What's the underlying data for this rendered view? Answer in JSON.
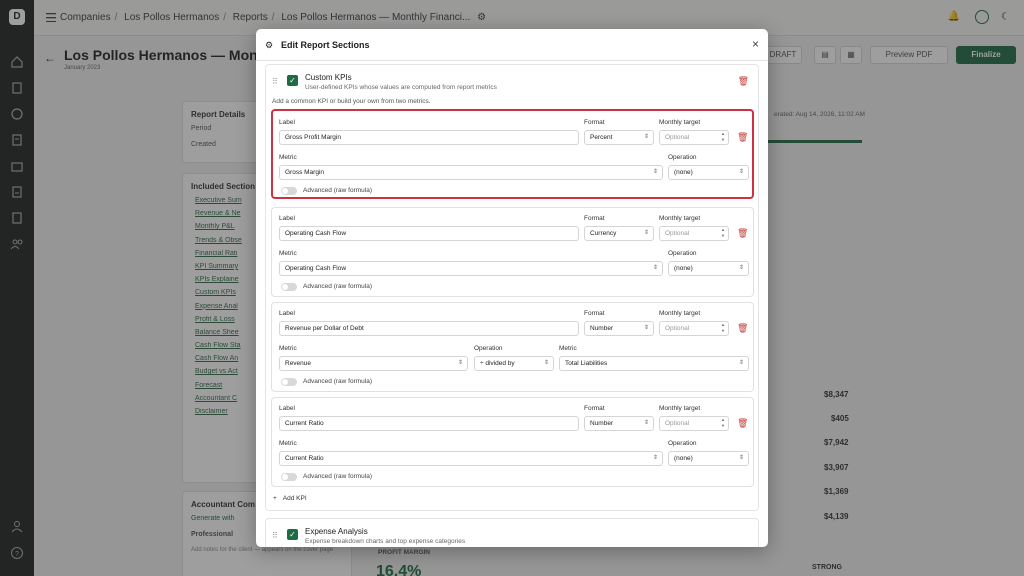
{
  "breadcrumb": [
    "Companies",
    "Los Pollos Hermanos",
    "Reports",
    "Los Pollos Hermanos — Monthly Financi..."
  ],
  "page": {
    "title": "Los Pollos Hermanos — Month",
    "subtitle": "January 2023",
    "draft_label": "DRAFT",
    "preview_label": "Preview PDF",
    "finalize_label": "Finalize",
    "generated_label": "erated: Aug 14, 2026, 11:02 AM"
  },
  "report_details": {
    "title": "Report Details",
    "period_label": "Period",
    "created_label": "Created"
  },
  "included_sections": {
    "title": "Included Section",
    "items": [
      "Executive Sum",
      "Revenue & Ne",
      "Monthly P&L",
      "Trends & Obse",
      "Financial Rati",
      "KPI Summary",
      "KPIs Explaine",
      "Custom KPIs",
      "Expense Anal",
      "Profit & Loss",
      "Balance Shee",
      "Cash Flow Sta",
      "Cash Flow An",
      "Budget vs Act",
      "Forecast",
      "Accountant C",
      "Disclaimer"
    ]
  },
  "accountant": {
    "title": "Accountant Com",
    "generate_label": "Generate with",
    "tab_professional": "Professional",
    "note": "Add notes for the client — appears on the cover page"
  },
  "background_values": [
    "$8,347",
    "$405",
    "$7,942",
    "$3,907",
    "$1,369",
    "$4,139"
  ],
  "profit_margin": {
    "label": "PROFIT MARGIN",
    "value": "16.4%",
    "badge": "STRONG"
  },
  "modal": {
    "title": "Edit Report Sections",
    "custom_kpis": {
      "title": "Custom KPIs",
      "description": "User-defined KPIs whose values are computed from report metrics",
      "hint": "Add a common KPI or build your own from two metrics.",
      "field_labels": {
        "label": "Label",
        "format": "Format",
        "target": "Monthly target",
        "metric": "Metric",
        "operation": "Operation",
        "advanced": "Advanced (raw formula)",
        "target_placeholder": "Optional"
      },
      "kpis": [
        {
          "label": "Gross Profit Margin",
          "format": "Percent",
          "metric": "Gross Margin",
          "operation": "(none)"
        },
        {
          "label": "Operating Cash Flow",
          "format": "Currency",
          "metric": "Operating Cash Flow",
          "operation": "(none)"
        },
        {
          "label": "Revenue per Dollar of Debt",
          "format": "Number",
          "metric": "Revenue",
          "operation": "÷ divided by",
          "metric2": "Total Liabilities"
        },
        {
          "label": "Current Ratio",
          "format": "Number",
          "metric": "Current Ratio",
          "operation": "(none)"
        }
      ],
      "add_kpi_label": "Add KPI"
    },
    "expense_analysis": {
      "title": "Expense Analysis",
      "description": "Expense breakdown charts and top expense categories"
    }
  },
  "colors": {
    "accent": "#1f6b45",
    "highlight": "#cc3342",
    "danger": "#c23a3a"
  }
}
